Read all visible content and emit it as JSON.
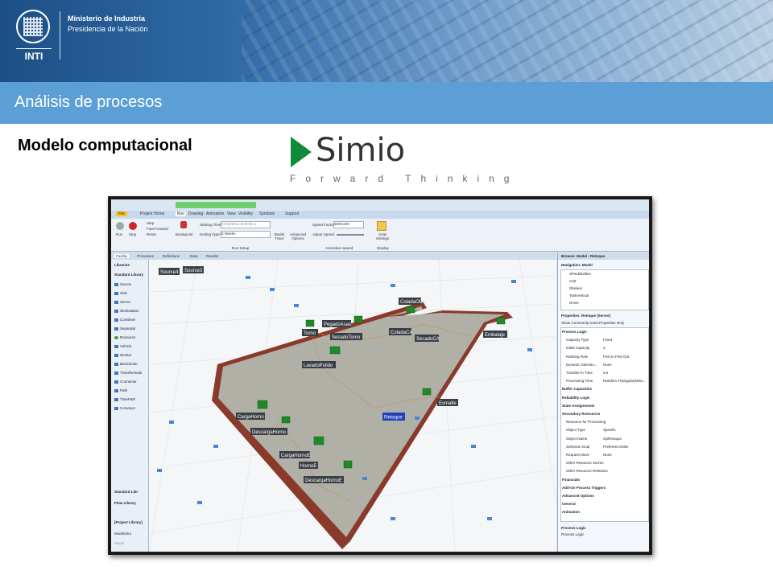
{
  "header": {
    "org_line1": "Ministerio de Industria",
    "org_line2": "Presidencia de la Nación",
    "logo_text": "INTI"
  },
  "title_bar": {
    "title": "Análisis de procesos"
  },
  "subtitle": "Modelo computacional",
  "simio_logo": {
    "word": "Simio",
    "tagline": "Forward Thinking",
    "color": "#0f8a3a"
  },
  "app": {
    "ribbon_tabs": [
      "File",
      "Project Home",
      "Run",
      "Drawing",
      "Animation",
      "View",
      "Visibility",
      "Symbols",
      "Support"
    ],
    "run_group": [
      "Run",
      "Stop",
      "Step",
      "Fast-Forward",
      "Reset"
    ],
    "breakpoint": "Breakpoint",
    "run_setup": {
      "starting_time_label": "Starting Time:",
      "starting_time_value": "07/04/2014 8:00:00 a.",
      "ending_type_label": "Ending Type:",
      "ending_type_value": "8 Weeks",
      "model_trace": "Model Trace",
      "advanced_options": "Advanced Options",
      "group_label": "Run Setup"
    },
    "animation_speed": {
      "speed_factor_label": "Speed Factor:",
      "speed_factor_value": "5000,000",
      "adjust_speed_label": "Adjust Speed:",
      "group_label": "Animation Speed"
    },
    "units_settings": "Units Settings",
    "display_label": "Display",
    "doc_tabs": [
      "Facility",
      "Processes",
      "Definitions",
      "Data",
      "Results"
    ],
    "libraries_title": "Libraries",
    "standard_library_title": "Standard Library",
    "library_items": [
      "Source",
      "Sink",
      "Server",
      "Workstation",
      "Combiner",
      "Separator",
      "Resource",
      "Vehicle",
      "Worker",
      "BasicNode",
      "TransferNode",
      "Connector",
      "Path",
      "TimePath",
      "Conveyor"
    ],
    "bottom_libs": [
      "Standard Libr",
      "Flow Library",
      "[Project Library]",
      "ModelIntro",
      "Model"
    ],
    "node_labels": [
      "Source4",
      "Source3",
      "ColadaOD",
      "Torno",
      "PegadoAsas",
      "SecadoTorno",
      "ColadaCA",
      "SecadoCA",
      "Embalaje",
      "LavadoPulido",
      "Esmalte",
      "Retoque",
      "CargaHorno",
      "DescargaHorno",
      "CargaHornoE",
      "HornoE",
      "DescargaHornoE"
    ],
    "props_panel": {
      "browse_title": "Browse: Model - Retoque",
      "nav_title": "Navigation: Model",
      "nav_items": [
        "SPackBottles",
        "Cart",
        "Shelves",
        "TankVertical",
        "Driver"
      ],
      "props_title": "Properties: Retoque (Server)",
      "show_common": "Show Commonly Used Properties Only",
      "rows": [
        [
          "Process Logic",
          ""
        ],
        [
          "Capacity Type",
          "Fixed"
        ],
        [
          "Initial Capacity",
          "3"
        ],
        [
          "Ranking Rule",
          "First In First Out"
        ],
        [
          "Dynamic Selectio...",
          "None"
        ],
        [
          "Transfer-In Time",
          "0.0"
        ],
        [
          "Processing Time",
          "Random.Triangular(Med..."
        ],
        [
          "Buffer Capacities",
          ""
        ],
        [
          "Reliability Logic",
          ""
        ],
        [
          "State Assignments",
          ""
        ],
        [
          "Secondary Resources",
          ""
        ],
        [
          "Resource for Processing",
          ""
        ],
        [
          "Object Type",
          "Specific"
        ],
        [
          "Object Name",
          "OpRetoque"
        ],
        [
          "Selection Goal",
          "Preferred Order"
        ],
        [
          "Request Move",
          "None"
        ],
        [
          "Other Resource Seizes",
          ""
        ],
        [
          "Other Resource Releases",
          ""
        ],
        [
          "Financials",
          ""
        ],
        [
          "Add-On Process Triggers",
          ""
        ],
        [
          "Advanced Options",
          ""
        ],
        [
          "General",
          ""
        ],
        [
          "Animation",
          ""
        ]
      ],
      "footer_title": "Process Logic",
      "footer_text": "Process Logic"
    }
  }
}
